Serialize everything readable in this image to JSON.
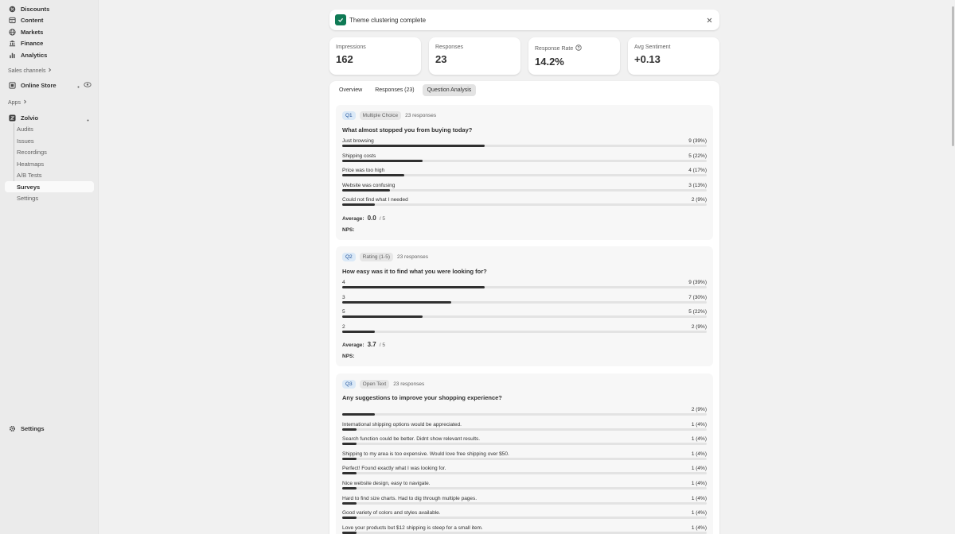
{
  "sidebar": {
    "items": [
      {
        "label": "Discounts",
        "icon": "discount-icon"
      },
      {
        "label": "Content",
        "icon": "content-icon"
      },
      {
        "label": "Markets",
        "icon": "globe-icon"
      },
      {
        "label": "Finance",
        "icon": "bank-icon"
      },
      {
        "label": "Analytics",
        "icon": "chart-icon"
      }
    ],
    "sales_channels_heading": "Sales channels",
    "online_store": "Online Store",
    "apps_heading": "Apps",
    "app_name": "Zolvio",
    "app_sub_items": [
      "Audits",
      "Issues",
      "Recordings",
      "Heatmaps",
      "A/B Tests",
      "Surveys",
      "Settings"
    ],
    "active_sub_item": "Surveys",
    "bottom_settings": "Settings"
  },
  "toast": {
    "message": "Theme clustering complete"
  },
  "metrics": [
    {
      "label": "Impressions",
      "value": "162"
    },
    {
      "label": "Responses",
      "value": "23"
    },
    {
      "label": "Response Rate",
      "value": "14.2%"
    },
    {
      "label": "Avg Sentiment",
      "value": "+0.13"
    }
  ],
  "tabs": [
    "Overview",
    "Responses (23)",
    "Question Analysis"
  ],
  "active_tab": "Question Analysis",
  "questions": [
    {
      "badge": "Q1",
      "type": "Multiple Choice",
      "count": "23 responses",
      "title": "What almost stopped you from buying today?",
      "options": [
        {
          "label": "Just browsing",
          "count": "9 (39%)",
          "pct": 39
        },
        {
          "label": "Shipping costs",
          "count": "5 (22%)",
          "pct": 22
        },
        {
          "label": "Price was too high",
          "count": "4 (17%)",
          "pct": 17
        },
        {
          "label": "Website was confusing",
          "count": "3 (13%)",
          "pct": 13
        },
        {
          "label": "Could not find what I needed",
          "count": "2 (9%)",
          "pct": 9
        }
      ],
      "average_label": "Average:",
      "average": "0.0",
      "average_max": "/ 5",
      "nps_label": "NPS:"
    },
    {
      "badge": "Q2",
      "type": "Rating (1-5)",
      "count": "23 responses",
      "title": "How easy was it to find what you were looking for?",
      "options": [
        {
          "label": "4",
          "count": "9 (39%)",
          "pct": 39
        },
        {
          "label": "3",
          "count": "7 (30%)",
          "pct": 30
        },
        {
          "label": "5",
          "count": "5 (22%)",
          "pct": 22
        },
        {
          "label": "2",
          "count": "2 (9%)",
          "pct": 9
        }
      ],
      "average_label": "Average:",
      "average": "3.7",
      "average_max": "/ 5",
      "nps_label": "NPS:"
    },
    {
      "badge": "Q3",
      "type": "Open Text",
      "count": "23 responses",
      "title": "Any suggestions to improve your shopping experience?",
      "options": [
        {
          "label": "",
          "count": "2 (9%)",
          "pct": 9
        },
        {
          "label": "International shipping options would be appreciated.",
          "count": "1 (4%)",
          "pct": 4
        },
        {
          "label": "Search function could be better. Didnt show relevant results.",
          "count": "1 (4%)",
          "pct": 4
        },
        {
          "label": "Shipping to my area is too expensive. Would love free shipping over $50.",
          "count": "1 (4%)",
          "pct": 4
        },
        {
          "label": "Perfect! Found exactly what I was looking for.",
          "count": "1 (4%)",
          "pct": 4
        },
        {
          "label": "Nice website design, easy to navigate.",
          "count": "1 (4%)",
          "pct": 4
        },
        {
          "label": "Hard to find size charts. Had to dig through multiple pages.",
          "count": "1 (4%)",
          "pct": 4
        },
        {
          "label": "Good variety of colors and styles available.",
          "count": "1 (4%)",
          "pct": 4
        },
        {
          "label": "Love your products but $12 shipping is steep for a small item.",
          "count": "1 (4%)",
          "pct": 4
        }
      ]
    }
  ]
}
